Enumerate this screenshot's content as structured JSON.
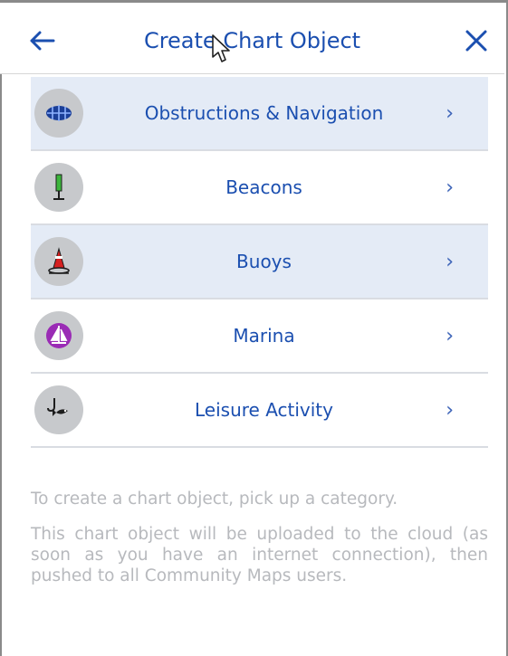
{
  "header": {
    "title": "Create Chart Object"
  },
  "categories": [
    {
      "label": "Obstructions & Navigation",
      "icon": "obstruction-icon",
      "shaded": true
    },
    {
      "label": "Beacons",
      "icon": "beacon-icon",
      "shaded": false
    },
    {
      "label": "Buoys",
      "icon": "buoy-icon",
      "shaded": true
    },
    {
      "label": "Marina",
      "icon": "marina-icon",
      "shaded": false
    },
    {
      "label": "Leisure Activity",
      "icon": "leisure-activity-icon",
      "shaded": false
    }
  ],
  "help": {
    "line1": "To create a chart object, pick up a category.",
    "line2": "This chart object will be uploaded to the cloud (as soon as you have an internet connection), then pushed to all Community Maps users."
  },
  "colors": {
    "accent": "#1b4fb0",
    "row_shade": "#e4ebf6",
    "icon_bg": "#c7c9cc",
    "help_text": "#b7b9bd"
  }
}
